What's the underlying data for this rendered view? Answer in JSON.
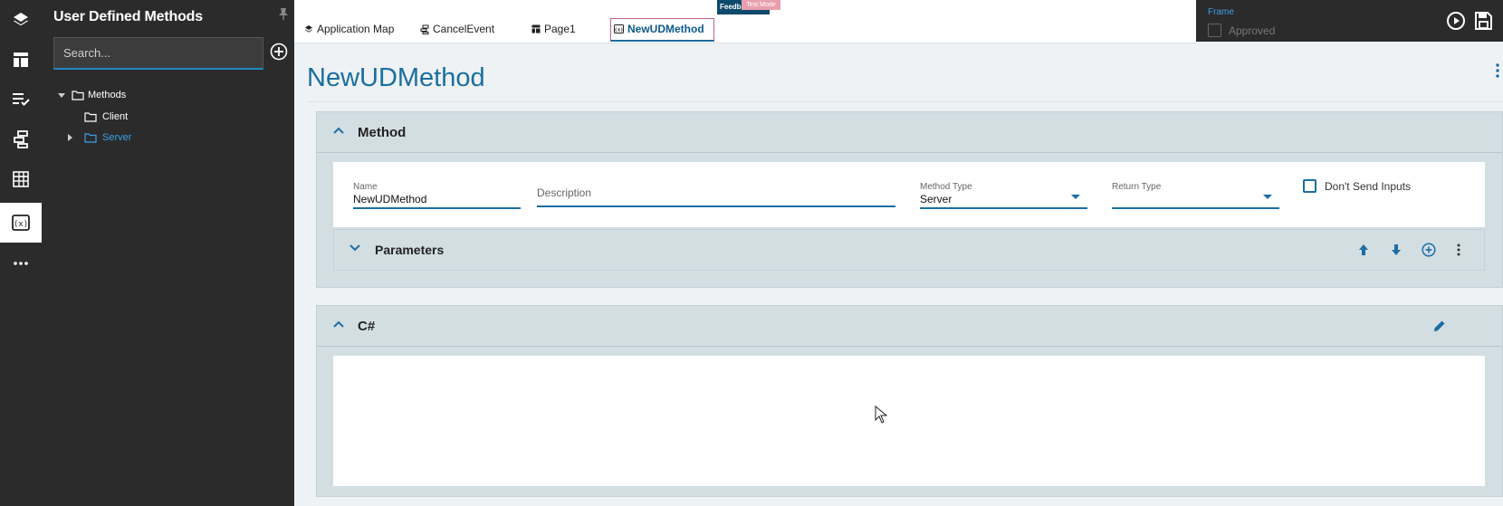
{
  "side_panel": {
    "title": "User Defined Methods",
    "search_placeholder": "Search...",
    "tree": [
      {
        "label": "Methods",
        "expanded": true
      },
      {
        "label": "Client"
      },
      {
        "label": "Server",
        "selected": true
      }
    ]
  },
  "tabs": [
    {
      "label": "Application Map",
      "icon": "layers-icon"
    },
    {
      "label": "CancelEvent",
      "icon": "event-icon"
    },
    {
      "label": "Page1",
      "icon": "page-icon"
    },
    {
      "label": "NewUDMethod",
      "icon": "method-icon",
      "active": true
    }
  ],
  "badges": {
    "feedback": "Feedb",
    "test_mode": "Test Mode"
  },
  "frame": {
    "label": "Frame",
    "approved_label": "Approved",
    "approved_checked": false
  },
  "page_title": "NewUDMethod",
  "method_section": {
    "title": "Method",
    "name_label": "Name",
    "name_value": "NewUDMethod",
    "description_placeholder": "Description",
    "method_type_label": "Method Type",
    "method_type_value": "Server",
    "return_type_label": "Return Type",
    "return_type_value": "",
    "dont_send_inputs_label": "Don't Send Inputs",
    "dont_send_inputs_checked": false,
    "parameters_title": "Parameters"
  },
  "code_section": {
    "title": "C#"
  },
  "colors": {
    "accent": "#1c6ea4",
    "dark_bg": "#2b2b2b",
    "section_bg": "#d3dee3",
    "title_blue": "#1a6fa0"
  }
}
